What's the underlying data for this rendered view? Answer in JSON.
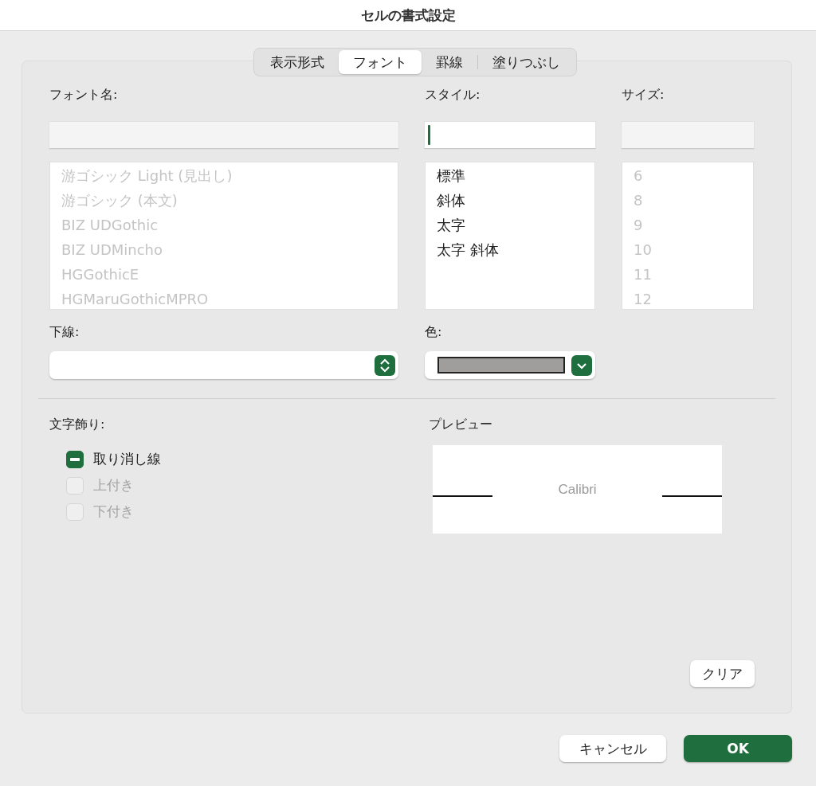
{
  "window": {
    "title": "セルの書式設定"
  },
  "tabs": [
    {
      "label": "表示形式",
      "selected": false
    },
    {
      "label": "フォント",
      "selected": true
    },
    {
      "label": "罫線",
      "selected": false
    },
    {
      "label": "塗りつぶし",
      "selected": false
    }
  ],
  "font_name": {
    "label": "フォント名:",
    "disabled": true,
    "focused": false,
    "items": [
      "游ゴシック Light (見出し)",
      "游ゴシック (本文)",
      "BIZ UDGothic",
      "BIZ UDMincho",
      "HGGothicE",
      "HGMaruGothicMPRO"
    ]
  },
  "style": {
    "label": "スタイル:",
    "disabled": false,
    "focused": true,
    "items": [
      "標準",
      "斜体",
      "太字",
      "太字 斜体"
    ]
  },
  "size": {
    "label": "サイズ:",
    "disabled": true,
    "focused": false,
    "items": [
      "6",
      "8",
      "9",
      "10",
      "11",
      "12"
    ]
  },
  "underline": {
    "label": "下線:"
  },
  "color": {
    "label": "色:",
    "color": "#a09d9d"
  },
  "effects": {
    "label": "文字飾り:",
    "items": [
      {
        "label": "取り消し線",
        "checked": true,
        "mixed": true,
        "disabled": false
      },
      {
        "label": "上付き",
        "checked": false,
        "disabled": true
      },
      {
        "label": "下付き",
        "checked": false,
        "disabled": true
      }
    ]
  },
  "preview": {
    "label": "プレビュー",
    "sample": "Calibri"
  },
  "clear_button": "クリア",
  "buttons": [
    {
      "label": "キャンセル",
      "kind": "secondary"
    },
    {
      "label": "OK",
      "kind": "primary"
    }
  ]
}
